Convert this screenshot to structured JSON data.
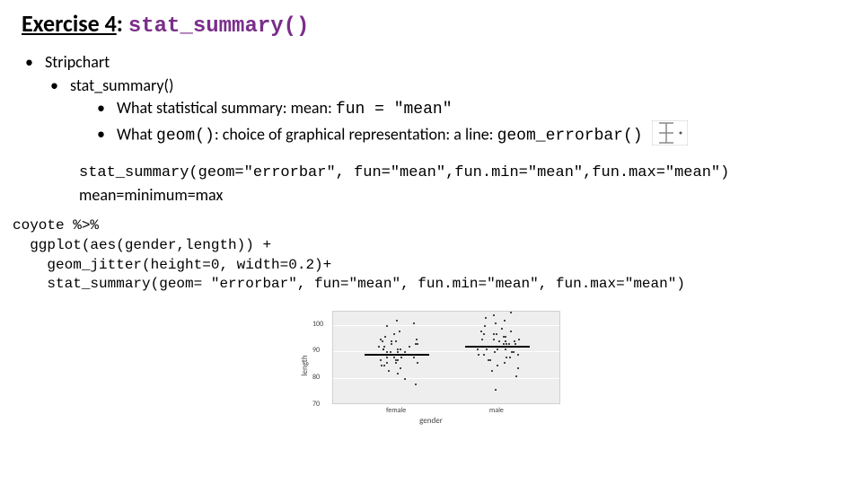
{
  "title": {
    "exercise": "Exercise 4",
    "fn": "stat_summary()"
  },
  "bullets": {
    "stripchart": "Stripchart",
    "stat_summary": "stat_summary()",
    "line1_a": "What statistical summary: mean: ",
    "line1_b": "fun = \"mean\"",
    "line2_a": "What ",
    "line2_b": "geom()",
    "line2_c": ": choice of graphical representation: a line: ",
    "line2_d": "geom_errorbar()"
  },
  "block2": {
    "code": "stat_summary(geom=\"errorbar\", fun=\"mean\",fun.min=\"mean\",fun.max=\"mean\")",
    "note": "mean=minimum=max"
  },
  "code": "coyote %>%\n  ggplot(aes(gender,length)) +\n    geom_jitter(height=0, width=0.2)+\n    stat_summary(geom= \"errorbar\", fun=\"mean\", fun.min=\"mean\", fun.max=\"mean\")",
  "chart_data": {
    "type": "scatter",
    "title": "",
    "xlabel": "gender",
    "ylabel": "length",
    "categories": [
      "female",
      "male"
    ],
    "ylim": [
      70,
      105
    ],
    "yticks": [
      70,
      80,
      90,
      100
    ],
    "series": [
      {
        "name": "female",
        "mean": 89,
        "y": [
          82,
          84,
          85,
          86,
          86,
          87,
          87,
          88,
          88,
          88,
          89,
          89,
          89,
          89,
          90,
          90,
          90,
          91,
          91,
          91,
          92,
          92,
          93,
          93,
          94,
          94,
          95,
          96,
          97,
          98,
          80,
          83,
          85,
          86,
          87,
          88,
          89,
          90,
          91,
          92,
          93,
          94,
          95,
          78,
          100,
          101,
          102
        ]
      },
      {
        "name": "male",
        "mean": 92,
        "y": [
          83,
          85,
          86,
          87,
          88,
          88,
          89,
          89,
          90,
          90,
          90,
          91,
          91,
          91,
          92,
          92,
          92,
          93,
          93,
          93,
          94,
          94,
          94,
          95,
          95,
          96,
          96,
          97,
          97,
          98,
          98,
          99,
          100,
          101,
          102,
          103,
          81,
          84,
          87,
          89,
          91,
          93,
          95,
          97,
          76,
          104,
          105
        ]
      }
    ]
  }
}
